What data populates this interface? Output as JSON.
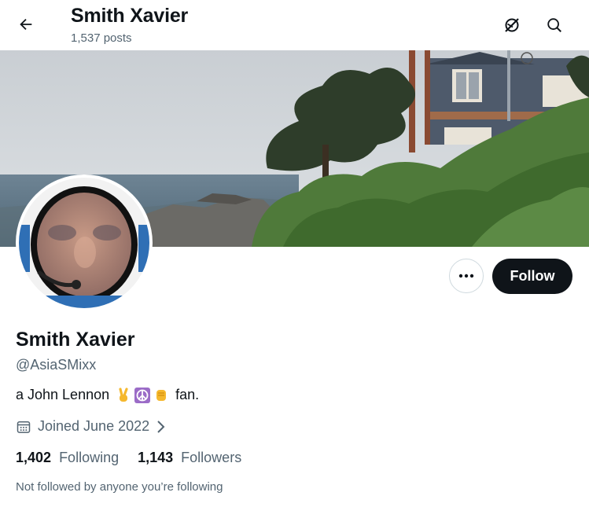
{
  "header": {
    "title": "Smith Xavier",
    "posts_count": "1,537 posts",
    "icons": [
      "back-arrow-icon",
      "grok-icon",
      "search-icon"
    ]
  },
  "profile": {
    "name": "Smith Xavier",
    "handle": "@AsiaSMixx",
    "bio_text": "a John Lennon",
    "bio_suffix": "fan.",
    "bio_emojis": [
      "victory-hand-emoji",
      "peace-symbol-emoji",
      "raised-fist-emoji"
    ],
    "joined": "Joined June 2022",
    "following_count": "1,402",
    "following_label": "Following",
    "followers_count": "1,143",
    "followers_label": "Followers",
    "followed_by_note": "Not followed by anyone you’re following"
  },
  "actions": {
    "follow_label": "Follow",
    "more_icon": "more-dots-icon"
  },
  "colors": {
    "text_primary": "#0f1419",
    "text_secondary": "#536471",
    "follow_bg": "#0f1419",
    "border": "#cfd9de"
  }
}
